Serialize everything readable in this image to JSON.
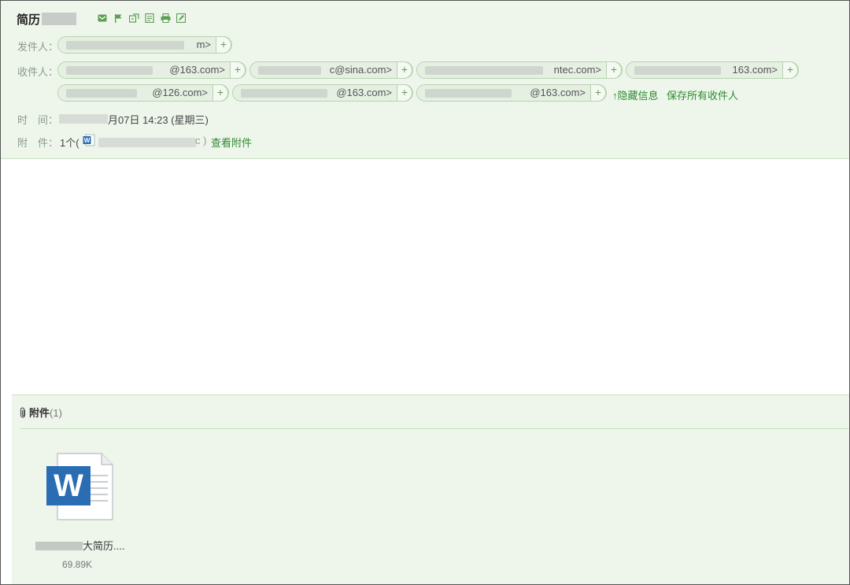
{
  "email": {
    "subject": "简历",
    "from_label": "发件人：",
    "from_address_suffix": "m>",
    "to_label": "收件人：",
    "recipients": [
      {
        "suffix": "@163.com>"
      },
      {
        "suffix": "c@sina.com>"
      },
      {
        "suffix": "ntec.com>"
      },
      {
        "suffix": "163.com>"
      },
      {
        "suffix": "@126.com>"
      },
      {
        "suffix": "@163.com>"
      },
      {
        "suffix": "@163.com>"
      }
    ],
    "hide_info_link": "↑隐藏信息",
    "save_recipients_link": "保存所有收件人",
    "time_label": "时　间：",
    "time_value": "月07日 14:23 (星期三)",
    "attach_label": "附　件：",
    "attach_count_text": "1个(",
    "attach_close": "c )",
    "view_attach_link": "查看附件",
    "plus_symbol": "+"
  },
  "toolbar_icons": [
    "mail-icon",
    "flag-icon",
    "tag-icon",
    "note-icon",
    "print-icon",
    "edit-icon"
  ],
  "attachments_panel": {
    "title": "附件",
    "count": "(1)",
    "file": {
      "name": "大简历....",
      "size": "69.89K",
      "icon_letter": "W"
    }
  },
  "colors": {
    "header_bg": "#eef6ec",
    "accent_green": "#2e8b2e",
    "word_blue": "#2a6db3"
  }
}
